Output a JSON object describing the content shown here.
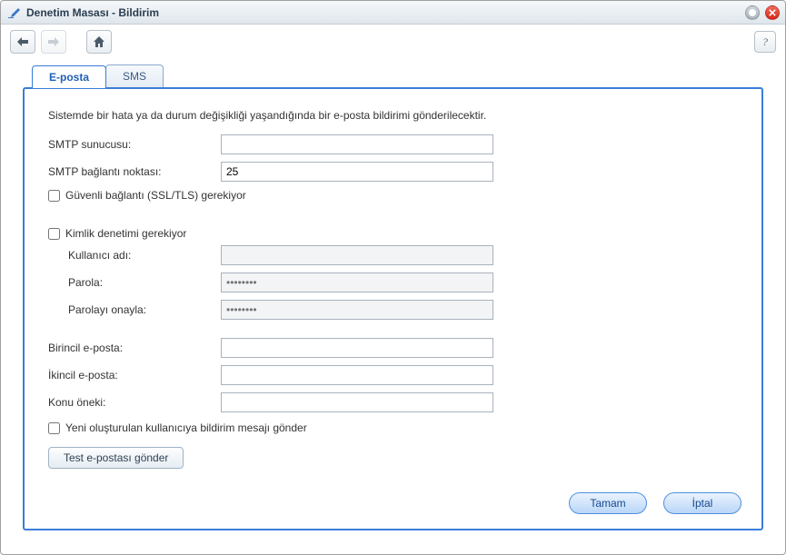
{
  "window": {
    "title": "Denetim Masası - Bildirim"
  },
  "toolbar": {
    "help_glyph": "?"
  },
  "tabs": {
    "email": "E-posta",
    "sms": "SMS"
  },
  "form": {
    "description": "Sistemde bir hata ya da durum değişikliği yaşandığında bir e-posta bildirimi gönderilecektir.",
    "smtp_server_label": "SMTP sunucusu:",
    "smtp_server_value": "",
    "smtp_port_label": "SMTP bağlantı noktası:",
    "smtp_port_value": "25",
    "ssl_label": "Güvenli bağlantı (SSL/TLS) gerekiyor",
    "ssl_checked": false,
    "auth_label": "Kimlik denetimi gerekiyor",
    "auth_checked": false,
    "username_label": "Kullanıcı adı:",
    "username_value": "",
    "password_label": "Parola:",
    "password_value": "",
    "confirm_label": "Parolayı onayla:",
    "confirm_value": "",
    "primary_email_label": "Birincil e-posta:",
    "primary_email_value": "",
    "secondary_email_label": "İkincil e-posta:",
    "secondary_email_value": "",
    "subject_prefix_label": "Konu öneki:",
    "subject_prefix_value": "",
    "notify_new_user_label": "Yeni oluşturulan kullanıcıya bildirim mesajı gönder",
    "notify_new_user_checked": false,
    "test_button": "Test e-postası gönder"
  },
  "buttons": {
    "ok": "Tamam",
    "cancel": "İptal"
  }
}
